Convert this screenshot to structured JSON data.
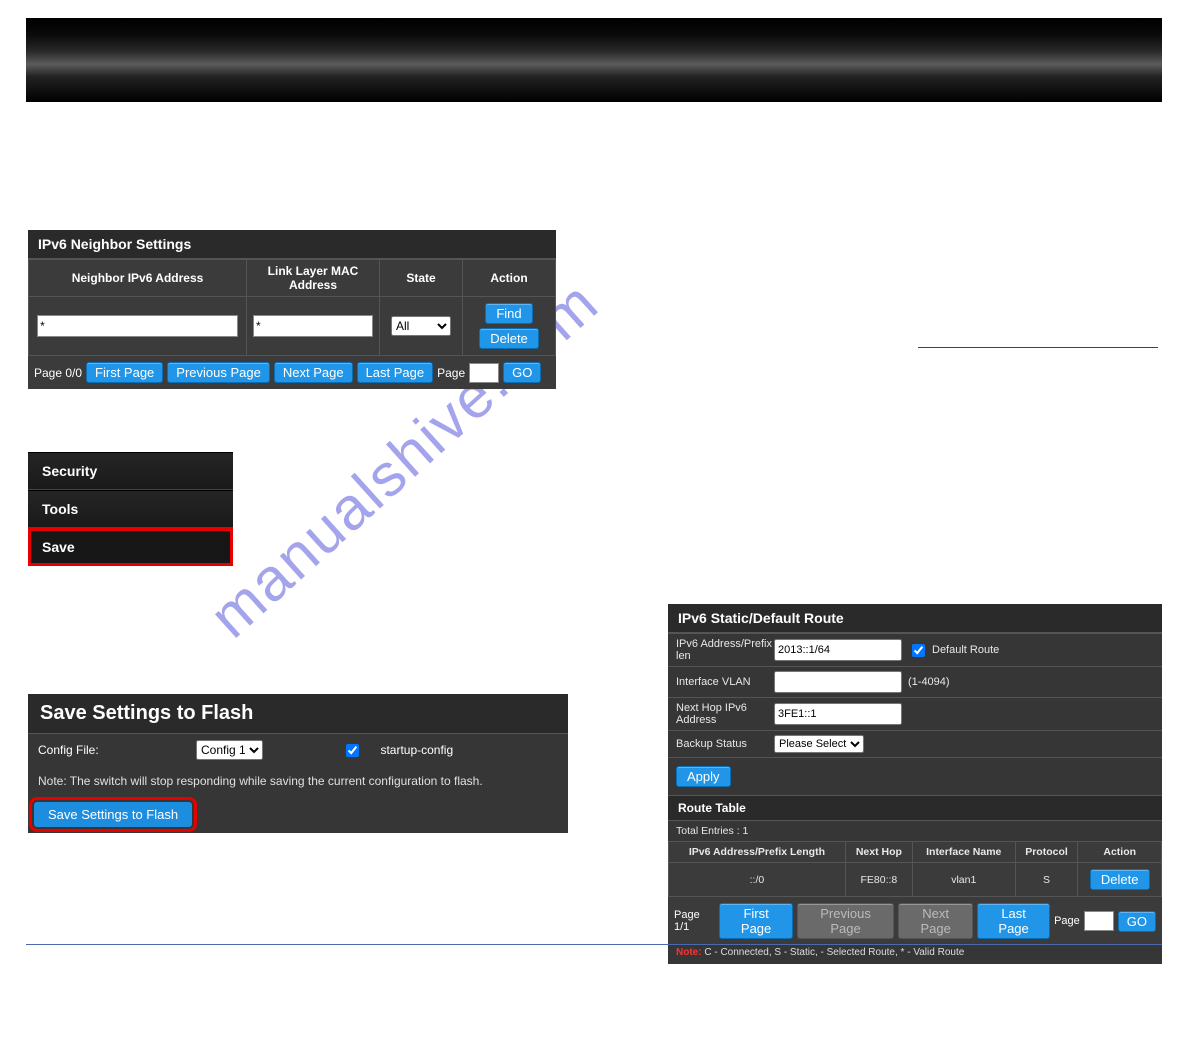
{
  "panel1": {
    "title": "IPv6 Neighbor Settings",
    "headers": [
      "Neighbor IPv6 Address",
      "Link Layer MAC Address",
      "State",
      "Action"
    ],
    "inputs": {
      "neighbor": "*",
      "mac": "*",
      "state": "All"
    },
    "actions": {
      "find": "Find",
      "delete": "Delete"
    },
    "pager": {
      "info": "Page 0/0",
      "first": "First Page",
      "prev": "Previous Page",
      "next": "Next Page",
      "last": "Last Page",
      "pageLabel": "Page",
      "go": "GO"
    }
  },
  "menu": {
    "items": [
      "Security",
      "Tools",
      "Save"
    ]
  },
  "panel3": {
    "title": "Save Settings to Flash",
    "configLabel": "Config File:",
    "configValue": "Config 1",
    "startupLabel": "startup-config",
    "note": "Note: The switch will stop responding while saving the current configuration to flash.",
    "button": "Save Settings to Flash"
  },
  "panel4": {
    "title": "IPv6 Static/Default Route",
    "rows": {
      "addrLabel": "IPv6 Address/Prefix len",
      "addrValue": "2013::1/64",
      "defaultRoute": "Default Route",
      "vlanLabel": "Interface VLAN",
      "vlanHint": "(1-4094)",
      "hopLabel": "Next Hop IPv6 Address",
      "hopValue": "3FE1::1",
      "backupLabel": "Backup Status",
      "backupValue": "Please Select"
    },
    "apply": "Apply",
    "routeTable": {
      "header": "Route Table",
      "total": "Total Entries : 1",
      "cols": [
        "IPv6 Address/Prefix Length",
        "Next Hop",
        "Interface Name",
        "Protocol",
        "Action"
      ],
      "row": [
        "::/0",
        "FE80::8",
        "vlan1",
        "S"
      ],
      "delete": "Delete"
    },
    "pager": {
      "info": "Page 1/1",
      "first": "First Page",
      "prev": "Previous Page",
      "next": "Next Page",
      "last": "Last Page",
      "pageLabel": "Page",
      "go": "GO"
    },
    "noteLabel": "Note:",
    "noteText": " C - Connected, S - Static, - Selected Route, * - Valid Route"
  },
  "watermark": "manualshive.com"
}
